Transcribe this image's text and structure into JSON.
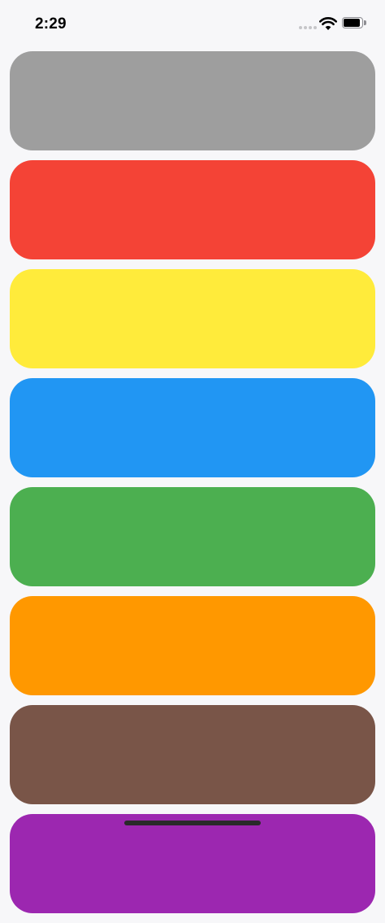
{
  "status_bar": {
    "time": "2:29",
    "icons": [
      "signal-icon",
      "wifi-icon",
      "battery-icon"
    ]
  },
  "cards": [
    {
      "color": "#9e9e9e"
    },
    {
      "color": "#f44336"
    },
    {
      "color": "#ffeb3b"
    },
    {
      "color": "#2196f3"
    },
    {
      "color": "#4caf50"
    },
    {
      "color": "#ff9800"
    },
    {
      "color": "#795548"
    },
    {
      "color": "#9c27b0"
    }
  ]
}
